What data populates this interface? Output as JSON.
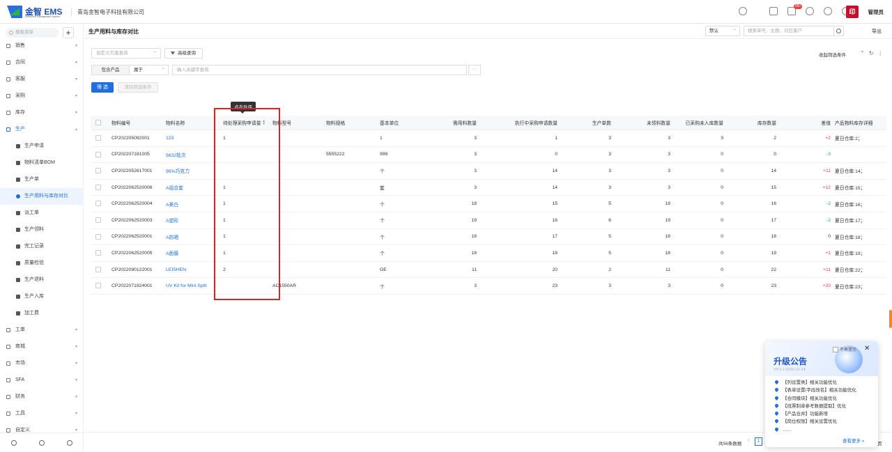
{
  "brand": {
    "name": "金智 EMS",
    "sub": "Enterprise Management System"
  },
  "company": "青岛金智电子科技有限公司",
  "topbar": {
    "badge": "99+",
    "avatar_text": "印",
    "user": "管理员"
  },
  "sidebar": {
    "search_placeholder": "搜索菜单",
    "items": [
      {
        "label": "销售",
        "type": "group"
      },
      {
        "label": "合同",
        "type": "group"
      },
      {
        "label": "客服",
        "type": "group"
      },
      {
        "label": "采购",
        "type": "group"
      },
      {
        "label": "库存",
        "type": "group"
      },
      {
        "label": "生产",
        "type": "open"
      },
      {
        "label": "生产申请",
        "type": "sub"
      },
      {
        "label": "物料清单BOM",
        "type": "sub"
      },
      {
        "label": "生产单",
        "type": "sub"
      },
      {
        "label": "生产用料与库存对比",
        "type": "active"
      },
      {
        "label": "派工单",
        "type": "sub"
      },
      {
        "label": "生产领料",
        "type": "sub"
      },
      {
        "label": "完工记录",
        "type": "sub"
      },
      {
        "label": "质量检验",
        "type": "sub"
      },
      {
        "label": "生产退料",
        "type": "sub"
      },
      {
        "label": "生产入库",
        "type": "sub"
      },
      {
        "label": "加工费",
        "type": "sub"
      },
      {
        "label": "工单",
        "type": "group"
      },
      {
        "label": "商城",
        "type": "group"
      },
      {
        "label": "市场",
        "type": "group"
      },
      {
        "label": "SFA",
        "type": "group"
      },
      {
        "label": "财务",
        "type": "group"
      },
      {
        "label": "工具",
        "type": "group"
      },
      {
        "label": "自定义",
        "type": "group"
      }
    ]
  },
  "header": {
    "title": "生产用料与库存对比",
    "view": "默认",
    "search_placeholder": "搜索单号、主题、对应客户",
    "export": "导出"
  },
  "filters": {
    "scheme_placeholder": "自定义方案查询",
    "advanced": "高级查询",
    "collapse": "收起筛选条件",
    "cond_field": "包含产品",
    "cond_op": "属于",
    "cond_placeholder": "输入关键字查询",
    "more": "···",
    "filter_btn": "筛 选",
    "clear_btn": "清除筛选条件"
  },
  "tooltip": "点击升序",
  "table": {
    "columns": [
      "物料编号",
      "物料名称",
      "待处理采购申请量",
      "物料型号",
      "物料规格",
      "基本单位",
      "需用料数量",
      "执行中采购申请数量",
      "生产单数",
      "未领料数量",
      "已采购未入库数量",
      "库存数量",
      "差值",
      "产品物料库存详细"
    ],
    "rows": [
      [
        "CP202205092001",
        "123",
        "1",
        "",
        "",
        "1",
        "3",
        "1",
        "3",
        "3",
        "3",
        "2",
        "+2",
        "夏日仓库:2；"
      ],
      [
        "CP202207181005",
        "5632批次",
        "",
        "",
        "5555222",
        "999",
        "3",
        "0",
        "3",
        "3",
        "0",
        "0",
        "-3",
        ""
      ],
      [
        "CP2022052617001",
        "95%巧克力",
        "",
        "",
        "",
        "个",
        "3",
        "14",
        "3",
        "3",
        "0",
        "14",
        "+11",
        "夏日仓库:14；"
      ],
      [
        "CP2022062520006",
        "A组合套",
        "1",
        "",
        "",
        "套",
        "3",
        "14",
        "3",
        "3",
        "0",
        "15",
        "+12",
        "夏日仓库:15；"
      ],
      [
        "CP2022062520004",
        "A美白",
        "1",
        "",
        "",
        "个",
        "18",
        "15",
        "5",
        "18",
        "0",
        "16",
        "-2",
        "夏日仓库:16；"
      ],
      [
        "CP2022062520003",
        "A塑形",
        "1",
        "",
        "",
        "个",
        "19",
        "16",
        "6",
        "19",
        "0",
        "17",
        "-2",
        "夏日仓库:17；"
      ],
      [
        "CP2022062520001",
        "A防晒",
        "1",
        "",
        "",
        "个",
        "18",
        "17",
        "5",
        "18",
        "0",
        "18",
        "0",
        "夏日仓库:18；"
      ],
      [
        "CP2022062520005",
        "A面膜",
        "1",
        "",
        "",
        "个",
        "18",
        "18",
        "5",
        "18",
        "0",
        "19",
        "+1",
        "夏日仓库:19；"
      ],
      [
        "CP2022090122001",
        "LEISHEN",
        "2",
        "",
        "",
        "GE",
        "11",
        "20",
        "2",
        "11",
        "0",
        "22",
        "+11",
        "夏日仓库:22；"
      ],
      [
        "CP2022071924001",
        "UV Kit for Mini Split",
        "",
        "AC1550AR",
        "",
        "个",
        "3",
        "23",
        "3",
        "3",
        "0",
        "23",
        "+20",
        "夏日仓库:23；"
      ]
    ]
  },
  "footer": {
    "total": "共56条数据",
    "page": "1",
    "pager_prev": "‹",
    "end": "页"
  },
  "notice": {
    "title": "升级公告",
    "version": "V4.0.2 2022-12-14",
    "dismiss": "不再提示",
    "close": "✕",
    "items": [
      "【列设置类】相关功能优化",
      "【表单设置/字段改名】相关功能优化",
      "【合同模块】相关功能优化",
      "【找票制单参考数据提取】优化",
      "【产品合并】功能新增",
      "【岗位权限】相关设置优化",
      "……"
    ],
    "more": "查看更多 »"
  }
}
